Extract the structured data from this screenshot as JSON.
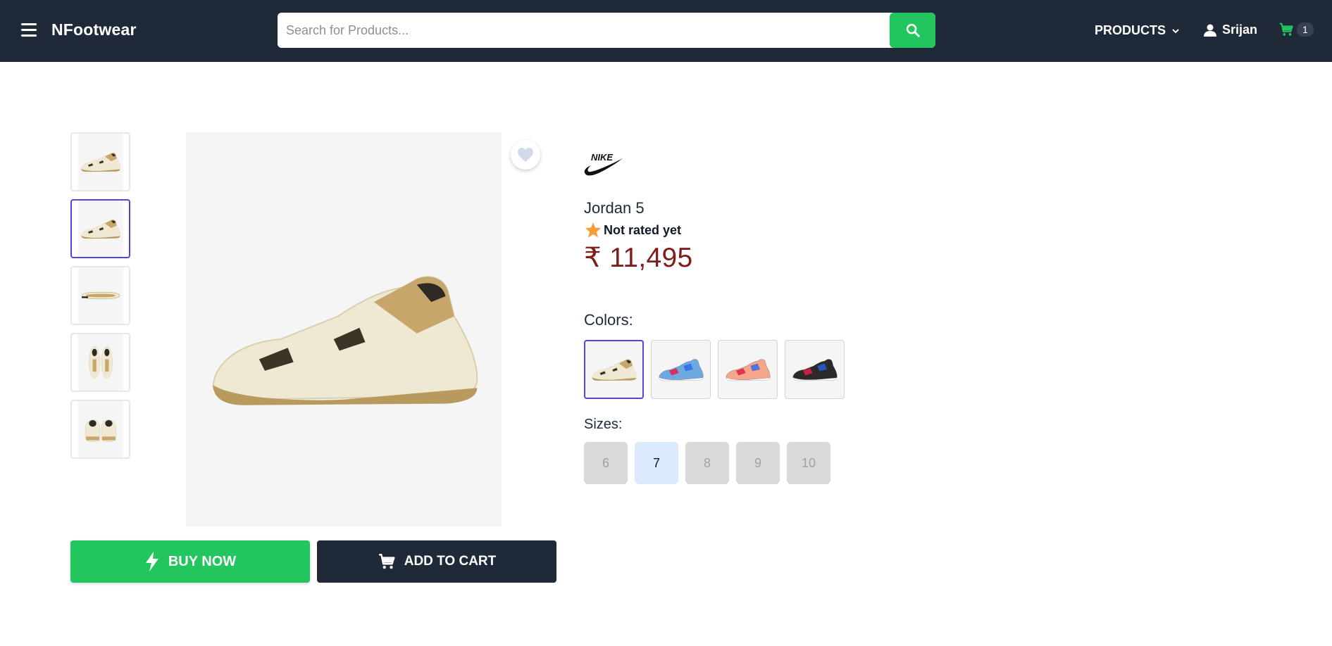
{
  "header": {
    "brand": "NFootwear",
    "search_placeholder": "Search for Products...",
    "products_label": "PRODUCTS",
    "user_name": "Srijan",
    "cart_count": "1"
  },
  "product": {
    "brand_logo_text": "NIKE",
    "name": "Jordan 5",
    "rating_text": "Not rated yet",
    "price": "₹ 11,495",
    "colors_label": "Colors:",
    "sizes_label": "Sizes:",
    "sizes": [
      "6",
      "7",
      "8",
      "9",
      "10"
    ],
    "selected_size": "7",
    "selected_color_index": 0,
    "selected_thumbnail_index": 1
  },
  "actions": {
    "buy_now": "BUY NOW",
    "add_to_cart": "ADD TO CART"
  },
  "colors": {
    "header_bg": "#1f2937",
    "accent_green": "#22c55e",
    "price_color": "#7f1d1d",
    "selection_border": "#4f46e5"
  }
}
